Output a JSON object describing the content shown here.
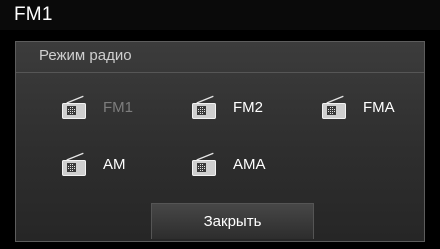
{
  "header": {
    "title": "FM1"
  },
  "dialog": {
    "title": "Режим радио",
    "options": [
      {
        "label": "FM1",
        "icon": "radio-icon",
        "state": "current"
      },
      {
        "label": "FM2",
        "icon": "radio-icon"
      },
      {
        "label": "FMA",
        "icon": "radio-icon"
      },
      {
        "label": "AM",
        "icon": "radio-icon"
      },
      {
        "label": "AMA",
        "icon": "radio-icon"
      }
    ],
    "close_label": "Закрыть"
  },
  "colors": {
    "background": "#000000",
    "dialog_top": "#3c3c3c",
    "dialog_bottom": "#262626",
    "text": "#ffffff",
    "disabled_text": "#7d7d7d",
    "border": "#5d5d5d"
  }
}
